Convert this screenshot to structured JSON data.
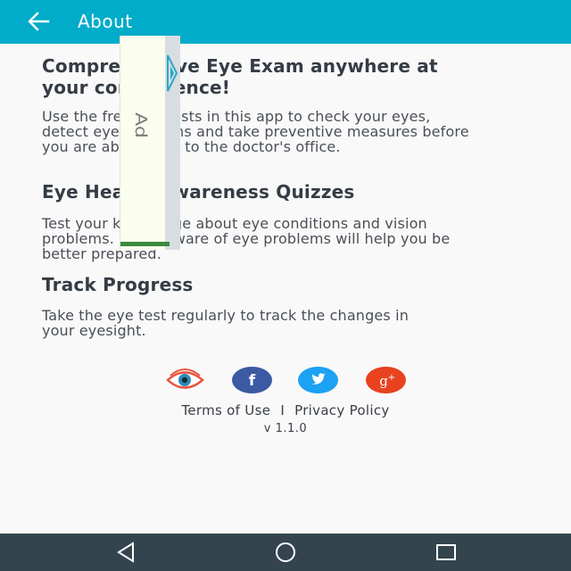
{
  "app_bar": {
    "title": "About",
    "back_icon": "arrow-left-icon",
    "color": "#00acc9"
  },
  "sections": [
    {
      "title": "Comprehensive Eye Exam anywhere at your convenience!",
      "text": "Use the free eye tests in this app to check your eyes, detect eye problems and take preventive measures before you are able to get to the doctor's office."
    },
    {
      "title": "Eye Health Awareness Quizzes",
      "text": "Test your knowledge about eye conditions and vision problems. Being aware of eye problems will help you be better prepared."
    },
    {
      "title": "Track Progress",
      "text": "Take the eye test regularly to track the changes in your eyesight."
    }
  ],
  "ad_overlay": {
    "label": "Ad"
  },
  "social": [
    {
      "name": "eye-logo-icon",
      "color": "#e8533f"
    },
    {
      "name": "facebook-icon",
      "color": "#3b5aa3"
    },
    {
      "name": "twitter-icon",
      "color": "#1da1f2"
    },
    {
      "name": "google-plus-icon",
      "color": "#e8421f"
    }
  ],
  "footer": {
    "terms": "Terms of Use",
    "separator": "I",
    "privacy": "Privacy Policy",
    "version": "v 1.1.0"
  },
  "nav_bar": {
    "back": "nav-back-icon",
    "home": "nav-home-icon",
    "recents": "nav-recents-icon",
    "color": "#34444e"
  }
}
